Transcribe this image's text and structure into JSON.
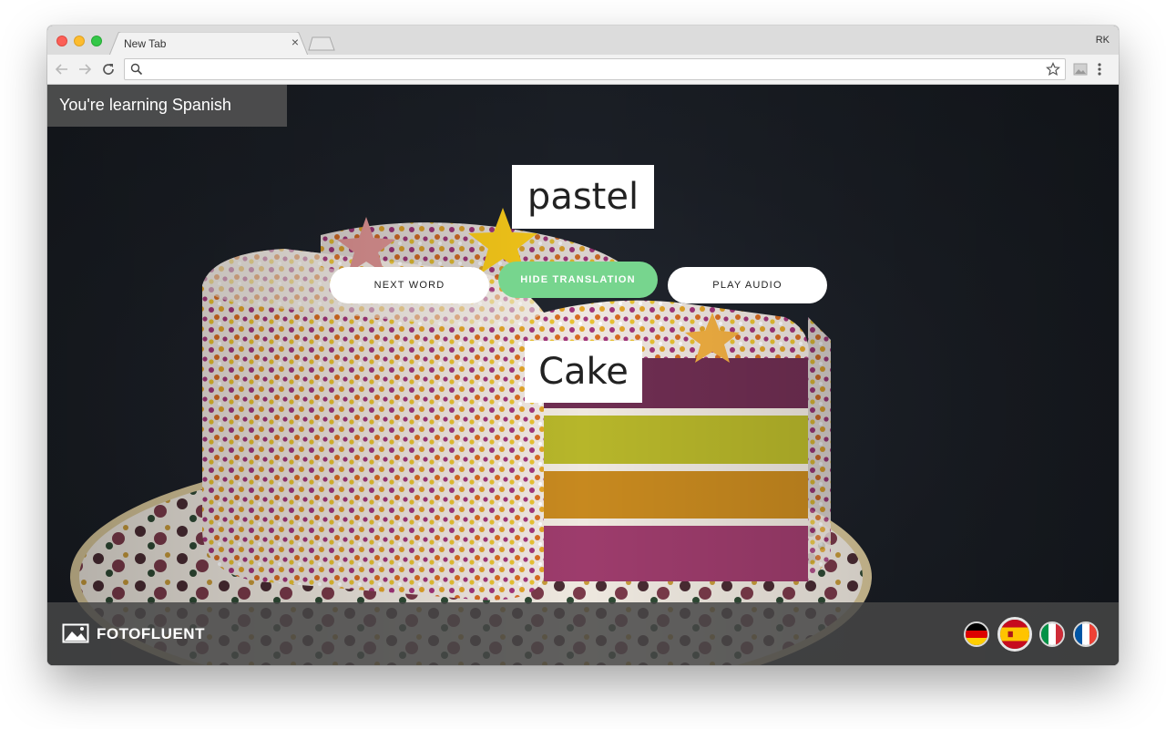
{
  "browser": {
    "tab_title": "New Tab",
    "tab_close": "×",
    "profile_initials": "RK",
    "omnibox_value": ""
  },
  "app": {
    "learning_label": "You're learning Spanish",
    "foreign_word": "pastel",
    "translation": "Cake",
    "buttons": {
      "next_word": "NEXT WORD",
      "hide_translation": "HIDE TRANSLATION",
      "play_audio": "PLAY AUDIO"
    },
    "brand": "FOTOFLUENT",
    "accent_color": "#77d58e",
    "languages": [
      {
        "code": "de",
        "icon": "german-flag-icon",
        "selected": false
      },
      {
        "code": "es",
        "icon": "spanish-flag-icon",
        "selected": true
      },
      {
        "code": "it",
        "icon": "italian-flag-icon",
        "selected": false
      },
      {
        "code": "fr",
        "icon": "french-flag-icon",
        "selected": false
      }
    ]
  }
}
